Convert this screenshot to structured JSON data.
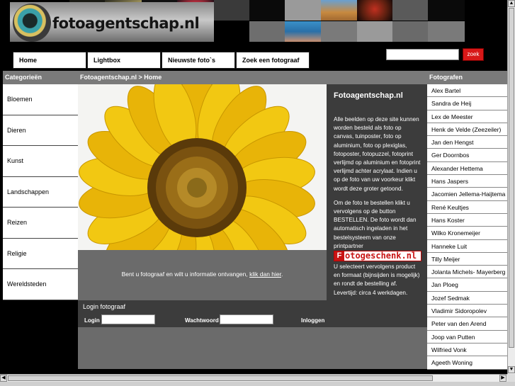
{
  "header": {
    "logo_text": "fotoagentschap.nl",
    "search_button_label": "zoek"
  },
  "nav": {
    "items": [
      "Home",
      "Lightbox",
      "Nieuwste foto`s",
      "Zoek een fotograaf"
    ]
  },
  "left": {
    "title": "Categorieën",
    "categories": [
      "Bloemen",
      "Dieren",
      "Kunst",
      "Landschappen",
      "Reizen",
      "Religie",
      "Wereldsteden"
    ]
  },
  "center": {
    "breadcrumb": "Fotoagentschap.nl > Home",
    "about_title": "Fotoagentschap.nl",
    "about_p1": "Alle beelden op deze site kunnen worden besteld als foto op canvas, tuinposter, foto op aluminium, foto op plexiglas, fotoposter, fotopuzzel, fotoprint verlijmd op aluminium en fotoprint verlijmd achter acrylaat. Indien u op de foto van uw voorkeur klikt wordt deze groter getoond.",
    "about_p2": "Om de foto te bestellen klikt u vervolgens op de button BESTELLEN. De foto wordt dan automatisch ingeladen in het bestelsysteem van onze printpartner",
    "partner_logo_letter": "F",
    "partner_logo_rest": "otogeschenk.nl",
    "about_p3": "U selecteert vervolgens product en formaat (bijnsijden is mogelijk) en rondt de bestelling af. Levertijd: circa 4 werkdagen.",
    "info_text": "Bent u fotograaf en wilt u informatie ontvangen, ",
    "info_link": "klik dan hier",
    "info_end": ".",
    "login_title": "Login fotograaf",
    "login_label": "Login",
    "password_label": "Wachtwoord",
    "login_button": "Inloggen"
  },
  "right": {
    "title": "Fotografen",
    "photographers": [
      "Alex Bartel",
      "Sandra de Heij",
      "Lex de Meester",
      "Henk de Velde (Zeezeiler)",
      "Jan den Hengst",
      "Ger Doornbos",
      "Alexander Hettema",
      "Hans Jaspers",
      "Jacomien Jellema-Haijtema",
      "René Keultjes",
      "Hans Koster",
      "Wilko Kronemeijer",
      "Hanneke Luit",
      "Tilly Meijer",
      "Jolanta Michels- Mayerberg",
      "Jan Ploeg",
      "Jozef Sedmak",
      "Vladimir Sidoropolev",
      "Peter van den Arend",
      "Joop van Putten",
      "Wilfried Vonk",
      "Ageeth Woning"
    ]
  }
}
